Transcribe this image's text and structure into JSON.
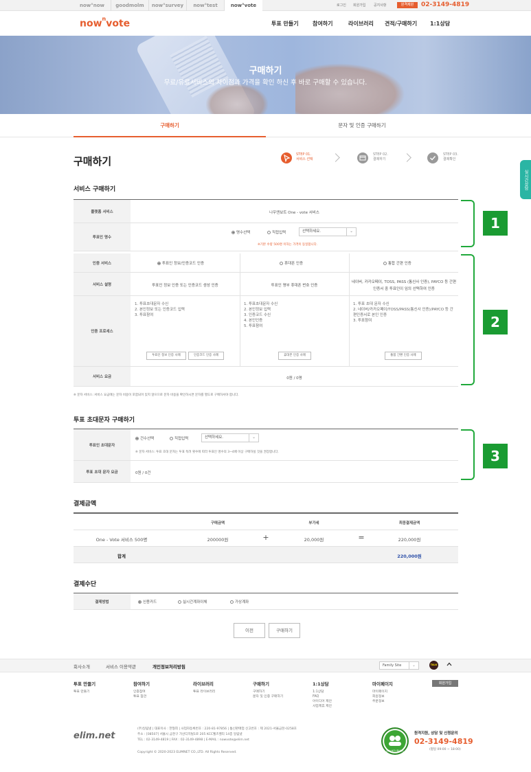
{
  "site_tabs": [
    "now°now",
    "goodmolm",
    "now°survey",
    "now°test",
    "now°vote"
  ],
  "top_links": [
    "로그인",
    "회원가입",
    "공지사항"
  ],
  "top_badge": "원격제원",
  "top_phone": "02-3149-4819",
  "logo": {
    "main": "now",
    "sup": "n",
    "tail": "vote"
  },
  "nav": [
    "투표 만들기",
    "참여하기",
    "라이브러리",
    "견적/구매하기",
    "1:1상담"
  ],
  "hero": {
    "title": "구매하기",
    "subtitle": "무료/유료서비스의 차이점과 가격을 확인 하신 후 바로 구매할 수 있습니다."
  },
  "page_tabs": [
    "구매하기",
    "문자 및 인증 구매하기"
  ],
  "page_title": "구매하기",
  "steps": [
    {
      "num": "STEP 01.",
      "label": "서비스 선택"
    },
    {
      "num": "STEP 02.",
      "label": "결제하기"
    },
    {
      "num": "STEP 03.",
      "label": "결제확인"
    }
  ],
  "side_tab": "실시간상담",
  "service": {
    "section_title": "서비스 구매하기",
    "platform_label": "플랫폼 서비스",
    "platform_value": "나우앤보트 One - vote 서비스",
    "voters_label": "투표인 명수",
    "radio1": "명수선택",
    "radio2": "직접입력",
    "select_placeholder": "선택하세요.",
    "voters_note": "※기본 수량 500명 이하는 가격이 동일합니다.",
    "auth_label": "인증 서비스",
    "auth_options": [
      "투표인 정보/인증코드 인증",
      "휴대폰 인증",
      "통합 간편 인증"
    ],
    "desc_label": "서비스 설명",
    "desc": [
      "투표인 정보 인증 또는 인증코드 생성 인증",
      "투표인 명부 휴대폰 번호 인증",
      "네이버, 카카오페이, TOSS, PASS (통신사 인증), PAYCO 등 간편인증서 중 투표인이 임의 선택하여 인증"
    ],
    "process_label": "인증 프로세스",
    "process": [
      [
        "1. 투표초대문자 수신",
        "2. 본인정보 또는 인증코드 입력",
        "3. 투표참여"
      ],
      [
        "1. 투표초대문자 수신",
        "2. 본인정보 입력",
        "3. 인증코드 수신",
        "4. 본인인증",
        "5. 투표참여"
      ],
      [
        "1. 투표 초대 문자 수신",
        "2. 네이버/카카오페이/TOSS/PASS(통신사 인증)/PAYCO 등 간편인증서로 본인 인증",
        "3. 투표참여"
      ]
    ],
    "process_buttons": [
      [
        "투표인 정보 인증 사례",
        "인증코드 인증 사례"
      ],
      [
        "휴대폰 인증 사례"
      ],
      [
        "통합 간편 인증 사례"
      ]
    ],
    "fee_label": "서비스 요금",
    "fee_value": "0원 / 0명",
    "footnote": "※ 문자 서비스: 서비스 요금에는 문자 비용이 포함되어 있지 않으므로 문자 비용을 확인하시면 문자를 별도로 구매하셔야 합니다."
  },
  "sms": {
    "section_title": "투표 초대문자 구매하기",
    "label": "투표인 초대문자",
    "radio1": "건수선택",
    "radio2": "직접입력",
    "select_placeholder": "선택하세요.",
    "note": "※ 문자 서비스: 투표 초대 문자는 투표 독려 횟수에 따라 투표인 명수의 3~4배 이상 구매하실 것을 권장합니다.",
    "fee_label": "투표 초대 문자 요금",
    "fee_value": "0원 / 0건"
  },
  "numbers": [
    "1",
    "2",
    "3"
  ],
  "payment": {
    "section_title": "결제금액",
    "headers": [
      "구매금액",
      "부가세",
      "최종결제금액"
    ],
    "item": "One - Vote 서비스 500명",
    "amount": "200000원",
    "plus": "+",
    "vat": "20,000원",
    "eq": "=",
    "final": "220,000원",
    "total_label": "합계",
    "total": "220,000원"
  },
  "method": {
    "section_title": "결제수단",
    "label": "결제방법",
    "options": [
      "신용카드",
      "실시간계좌이체",
      "가상계좌"
    ]
  },
  "buttons": {
    "prev": "이전",
    "buy": "구매하기"
  },
  "footer": {
    "links": [
      "회사소개",
      "서비스 이용약관",
      "개인정보처리방침"
    ],
    "family": "Family Site",
    "kakao": "TALK",
    "cols": [
      {
        "title": "투표 만들기",
        "items": [
          "투표 만들기"
        ]
      },
      {
        "title": "참여하기",
        "items": [
          "인증참여",
          "투표 참관"
        ]
      },
      {
        "title": "라이브러리",
        "items": [
          "투표 라이브러리"
        ]
      },
      {
        "title": "구매하기",
        "items": [
          "구매하기",
          "문자 및 인증 구매하기"
        ]
      },
      {
        "title": "1:1상담",
        "items": [
          "1:1상담",
          "FAQ",
          "아이디어 제안",
          "사업제휴 제안"
        ]
      },
      {
        "title": "마이페이지",
        "items": [
          "마이페이지",
          "회원정보",
          "주문정보"
        ]
      }
    ],
    "join": "회원가입",
    "company_logo": "elim.net",
    "info": [
      "(주)일림넷 | 대표이사 : 한형희 | 사업자등록번호 : 220-81-97856 | 통신판매업 신고번호 : 제 2021-서울금천-0258호",
      "주소 : [08507] 서울시 금천구 가산디지털1로 205 KCC웰츠밸리 14층 일림넷",
      "TEL : 02-3149-4819 | FAX : 02-3149-4898 | E-MAIL : nowvote@elim.net"
    ],
    "copyright": "Copyright © 2020-2023 ELIMNET CO.,LTD. All Rights Reserved.",
    "contact_title": "원격지원, 상담 및 신청문의",
    "contact_phone": "02-3149-4819",
    "contact_hours": "(평일 09:00 ~ 18:00)",
    "award": "정보보호우수웹사이트"
  }
}
